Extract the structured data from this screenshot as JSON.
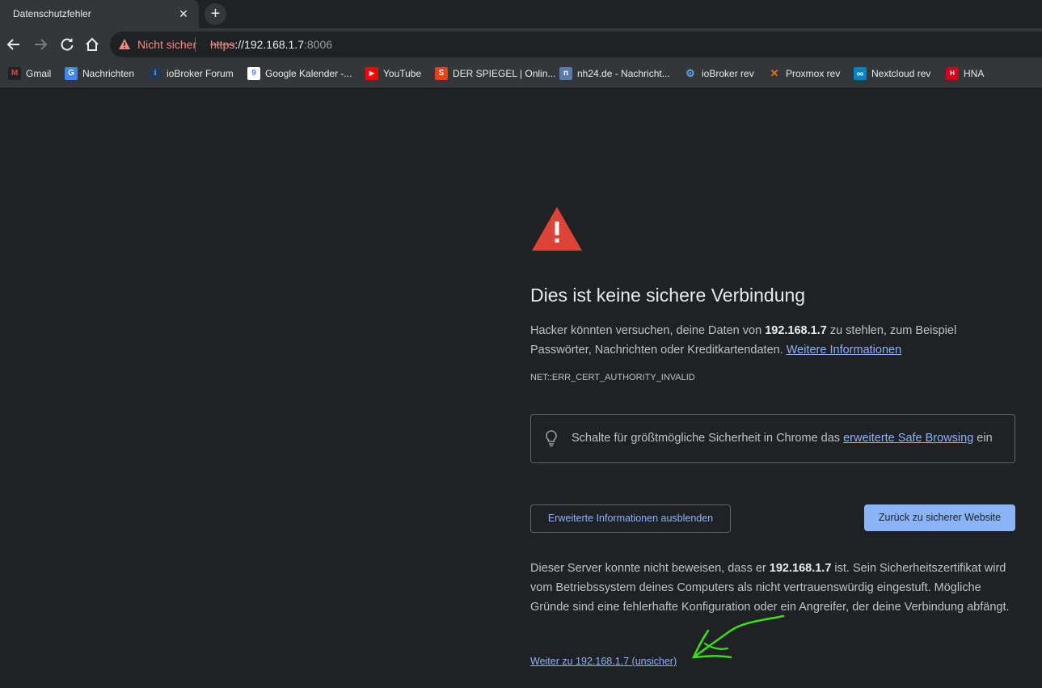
{
  "tab": {
    "title": "Datenschutzfehler",
    "close": "✕",
    "new_tab": "+"
  },
  "omnibox": {
    "security_label": "Nicht sicher",
    "url_scheme": "https",
    "url_rest": "://192.168.1.7",
    "url_port": ":8006"
  },
  "bookmarks": [
    {
      "label": "Gmail",
      "icon": "gmail-icon",
      "color": "#ea4335",
      "glyph": "M"
    },
    {
      "label": "Nachrichten",
      "icon": "google-news-icon",
      "color": "#4285f4",
      "glyph": "G"
    },
    {
      "label": "ioBroker Forum",
      "icon": "iobroker-icon",
      "color": "#3399cc",
      "glyph": "i"
    },
    {
      "label": "Google Kalender -...",
      "icon": "google-calendar-icon",
      "color": "#4285f4",
      "glyph": "9"
    },
    {
      "label": "YouTube",
      "icon": "youtube-icon",
      "color": "#ff0000",
      "glyph": "▶"
    },
    {
      "label": "DER SPIEGEL | Onlin...",
      "icon": "spiegel-icon",
      "color": "#e64415",
      "glyph": "S"
    },
    {
      "label": "nh24.de - Nachricht...",
      "icon": "nh24-icon",
      "color": "#5a7ca8",
      "glyph": "n"
    },
    {
      "label": "ioBroker rev",
      "icon": "iobroker-gear-icon",
      "color": "#2b6cb0",
      "glyph": "⚙"
    },
    {
      "label": "Proxmox rev",
      "icon": "proxmox-icon",
      "color": "#e57000",
      "glyph": "✕"
    },
    {
      "label": "Nextcloud rev",
      "icon": "nextcloud-icon",
      "color": "#0082c9",
      "glyph": "∞"
    },
    {
      "label": "HNA",
      "icon": "hna-icon",
      "color": "#d0021b",
      "glyph": "H"
    }
  ],
  "page": {
    "heading": "Dies ist keine sichere Verbindung",
    "para1_a": "Hacker könnten versuchen, deine Daten von ",
    "para1_host": "192.168.1.7",
    "para1_b": " zu stehlen, zum Beispiel Passwörter, Nachrichten oder Kreditkartendaten. ",
    "more_info_link": "Weitere Informationen",
    "error_code": "NET::ERR_CERT_AUTHORITY_INVALID",
    "sb_text_a": "Schalte für größtmögliche Sicherheit in Chrome das ",
    "sb_link": "erweiterte Safe Browsing",
    "sb_text_b": " ein",
    "hide_details_button": "Erweiterte Informationen ausblenden",
    "back_button": "Zurück zu sicherer Website",
    "para3_a": "Dieser Server konnte nicht beweisen, dass er ",
    "para3_host": "192.168.1.7",
    "para3_b": " ist. Sein Sicherheitszertifikat wird vom Betriebssystem deines Computers als nicht vertrauenswürdig eingestuft. Mögliche Gründe sind eine fehlerhafte Konfiguration oder ein Angreifer, der deine Verbindung abfängt.",
    "proceed_link": "Weiter zu 192.168.1.7 (unsicher)"
  },
  "colors": {
    "background": "#202124",
    "link": "#8ab4f8",
    "danger": "#db4437",
    "annotation": "#3ddc18"
  }
}
